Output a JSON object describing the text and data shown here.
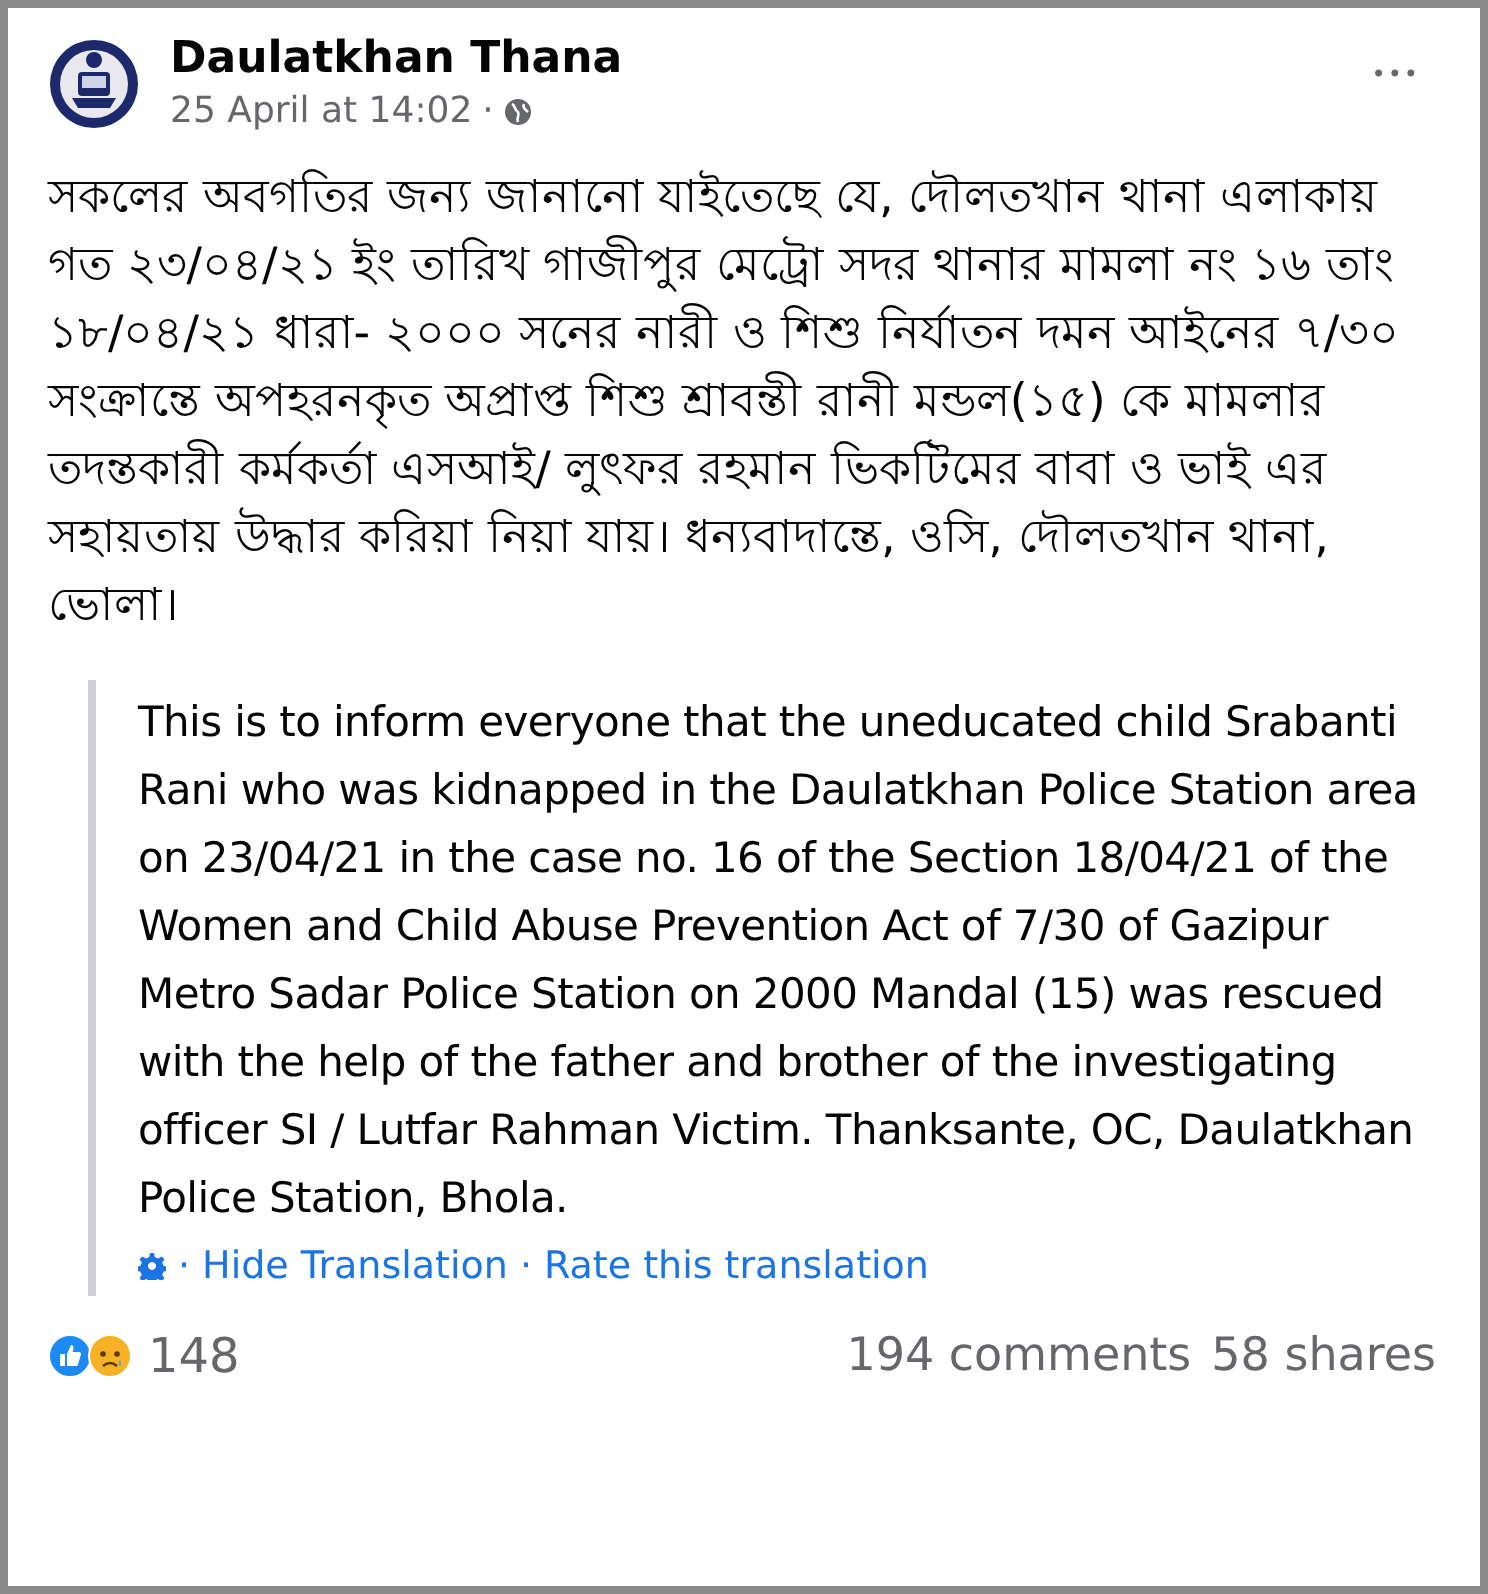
{
  "post": {
    "author": "Daulatkhan Thana",
    "timestamp": "25 April at 14:02",
    "separator": "·",
    "text": "সকলের অবগতির জন্য জানানো যাইতেছে যে, দৌলতখান থানা এলাকায় গত ২৩/০৪/২১ ইং তারিখ গাজীপুর মেট্রো সদর থানার মামলা নং ১৬ তাং ১৮/০৪/২১ ধারা- ২০০০ সনের নারী ও শিশু নির্যাতন দমন আইনের ৭/৩০ সংক্রান্তে অপহরনকৃত অপ্রাপ্ত শিশু শ্রাবন্তী রানী মন্ডল(১৫) কে মামলার তদন্তকারী কর্মকর্তা এসআই/ লুৎফর রহমান ভিকটিমের বাবা ও ভাই এর সহায়তায় উদ্ধার করিয়া নিয়া যায়। ধন্যবাদান্তে, ওসি, দৌলতখান থানা, ভোলা।",
    "menu": "•••"
  },
  "translation": {
    "text": "This is to inform everyone that the uneducated child Srabanti Rani who was kidnapped in the Daulatkhan Police Station area on 23/04/21 in the case no. 16 of the Section 18/04/21 of the Women and Child Abuse Prevention Act of 7/30 of Gazipur Metro Sadar Police Station on 2000 Mandal (15) was rescued with the help of the father and brother of the investigating officer SI / Lutfar Rahman Victim. Thanksante, OC, Daulatkhan Police Station, Bhola.",
    "links": [
      {
        "separator": "·",
        "label": "Hide Translation"
      },
      {
        "separator": "·",
        "label": "Rate this translation"
      }
    ]
  },
  "footer": {
    "reactions_count": "148",
    "comments": "194 comments",
    "shares": "58 shares"
  }
}
